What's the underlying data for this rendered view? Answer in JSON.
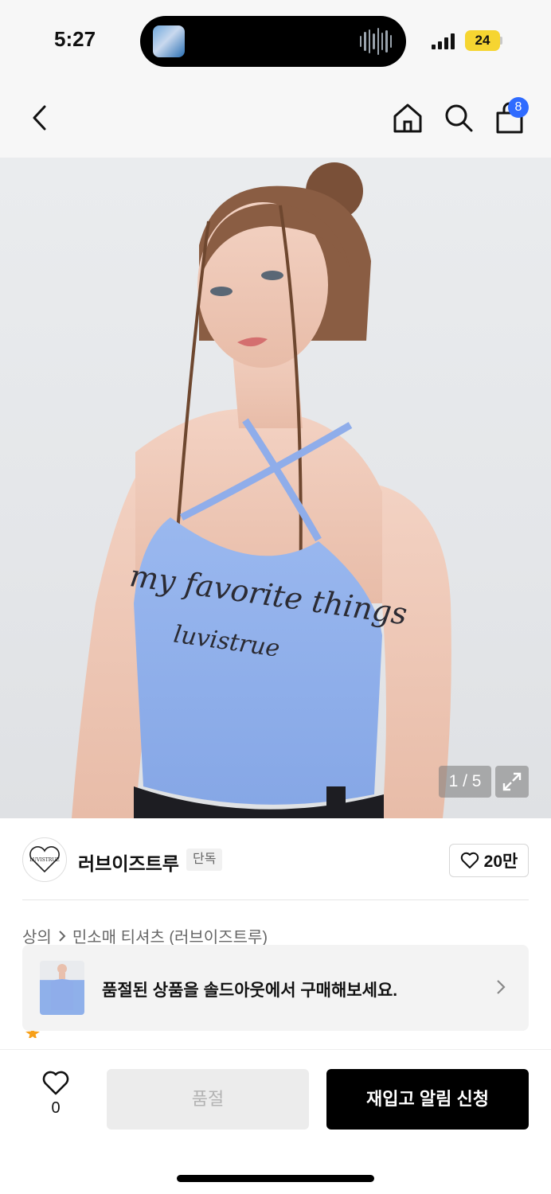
{
  "status_bar": {
    "time": "5:27",
    "battery": "24",
    "icons": [
      "now-playing-thumbnail",
      "audio-waveform-icon",
      "signal-icon",
      "battery-icon"
    ]
  },
  "nav": {
    "icons": [
      "back-icon",
      "home-icon",
      "search-icon",
      "shopping-bag-icon"
    ],
    "cart_count": "8"
  },
  "product_image": {
    "page_indicator": "1 / 5",
    "shirt_print_line1": "my favorite things",
    "shirt_print_line2": "luvistrue"
  },
  "brand": {
    "name": "러브이즈트루",
    "badge": "단독",
    "likes": "20만",
    "logo_text": "LUVISTRUE"
  },
  "breadcrumb": {
    "category": "상의",
    "subcategory": "민소매 티셔츠 (러브이즈트루)"
  },
  "soldout_banner": {
    "text": "품절된 상품을 솔드아웃에서 구매해보세요."
  },
  "bottom_bar": {
    "wish_count": "0",
    "soldout_label": "품절",
    "restock_label": "재입고 알림 신청"
  },
  "colors": {
    "accent_blue": "#2f6bff",
    "top_blue": "#8fb0ea",
    "primary_black": "#000000"
  }
}
